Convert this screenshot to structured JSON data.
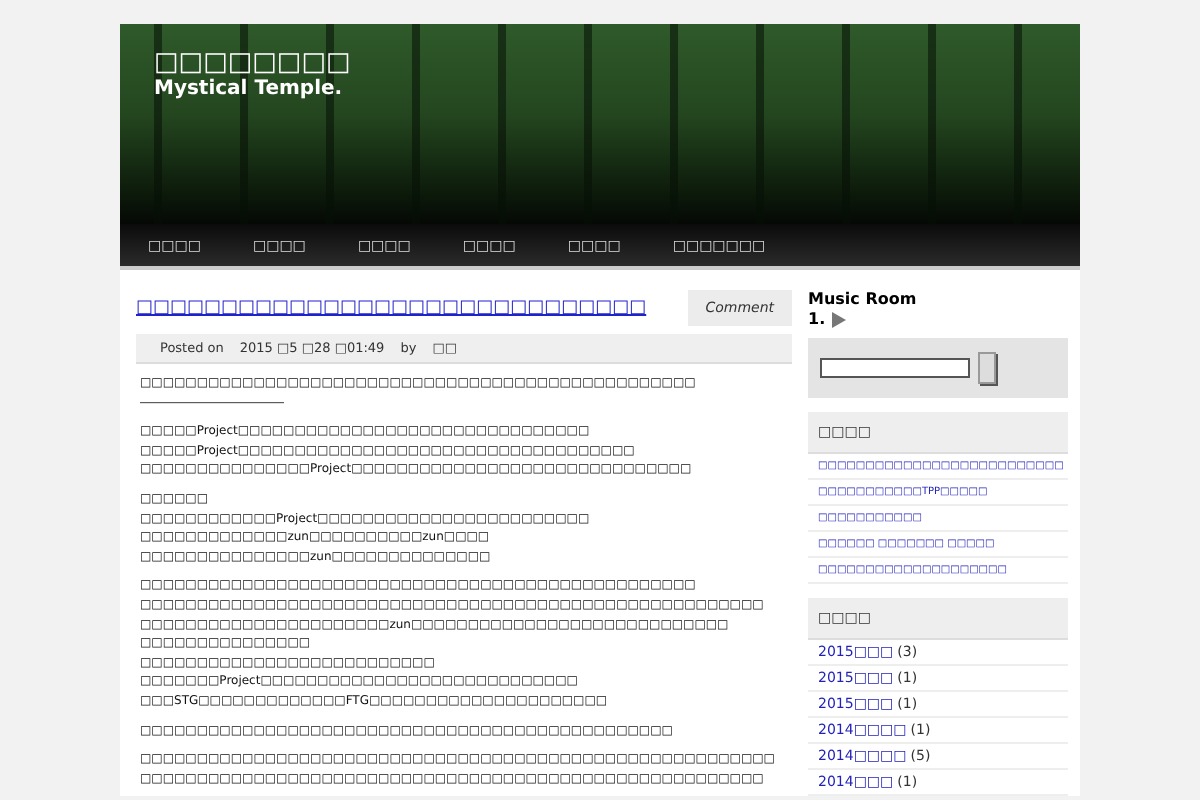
{
  "site": {
    "title": "□□□□□□□□",
    "subtitle": "Mystical Temple."
  },
  "nav": [
    {
      "label": "□□□□"
    },
    {
      "label": "□□□□"
    },
    {
      "label": "□□□□"
    },
    {
      "label": "□□□□"
    },
    {
      "label": "□□□□"
    },
    {
      "label": "□□□□□□□"
    }
  ],
  "post": {
    "title": "□□□□□□□□□□□□□□□□□□□□□□□□□□□□□□",
    "comment_button": "Comment",
    "meta": {
      "posted_label": "Posted on",
      "date": "2015 □5 □28 □01:49",
      "by_label": "by",
      "author": "□□"
    },
    "paragraphs": [
      [
        "□□□□□□□□□□□□□□□□□□□□□□□□□□□□□□□□□□□□□□□□□□□□□□□□□",
        "――――――――――――"
      ],
      [
        "□□□□□Project□□□□□□□□□□□□□□□□□□□□□□□□□□□□□□□",
        "□□□□□Project□□□□□□□□□□□□□□□□□□□□□□□□□□□□□□□□□□□",
        "□□□□□□□□□□□□□□□Project□□□□□□□□□□□□□□□□□□□□□□□□□□□□□□"
      ],
      [
        "□□□□□□",
        "□□□□□□□□□□□□Project□□□□□□□□□□□□□□□□□□□□□□□□",
        "□□□□□□□□□□□□□zun□□□□□□□□□□zun□□□□",
        "□□□□□□□□□□□□□□□zun□□□□□□□□□□□□□□"
      ],
      [
        "□□□□□□□□□□□□□□□□□□□□□□□□□□□□□□□□□□□□□□□□□□□□□□□□□",
        "□□□□□□□□□□□□□□□□□□□□□□□□□□□□□□□□□□□□□□□□□□□□□□□□□□□□□□□",
        "□□□□□□□□□□□□□□□□□□□□□□zun□□□□□□□□□□□□□□□□□□□□□□□□□□□□",
        "□□□□□□□□□□□□□□□",
        "□□□□□□□□□□□□□□□□□□□□□□□□□□",
        "□□□□□□□Project□□□□□□□□□□□□□□□□□□□□□□□□□□□□",
        "□□□STG□□□□□□□□□□□□□FTG□□□□□□□□□□□□□□□□□□□□□"
      ],
      [
        "□□□□□□□□□□□□□□□□□□□□□□□□□□□□□□□□□□□□□□□□□□□□□□□"
      ],
      [
        "□□□□□□□□□□□□□□□□□□□□□□□□□□□□□□□□□□□□□□□□□□□□□□□□□□□□□□□□",
        "□□□□□□□□□□□□□□□□□□□□□□□□□□□□□□□□□□□□□□□□□□□□□□□□□□□□□□□"
      ]
    ]
  },
  "sidebar": {
    "music": {
      "title": "Music Room",
      "track_number": "1."
    },
    "recent": {
      "heading": "□□□□",
      "links": [
        {
          "label": "□□□□□□□□□□□□□□□□□□□□□□□□□□"
        },
        {
          "label": "□□□□□□□□□□□TPP□□□□□"
        },
        {
          "label": "□□□□□□□□□□□"
        },
        {
          "label": "□□□□□□ □□□□□□□ □□□□□"
        },
        {
          "label": "□□□□□□□□□□□□□□□□□□□□"
        }
      ]
    },
    "archives": {
      "heading": "□□□□",
      "items": [
        {
          "label": "2015□□□",
          "count": "(3)"
        },
        {
          "label": "2015□□□",
          "count": "(1)"
        },
        {
          "label": "2015□□□",
          "count": "(1)"
        },
        {
          "label": "2014□□□□",
          "count": "(1)"
        },
        {
          "label": "2014□□□□",
          "count": "(5)"
        },
        {
          "label": "2014□□□",
          "count": "(1)"
        }
      ]
    }
  }
}
